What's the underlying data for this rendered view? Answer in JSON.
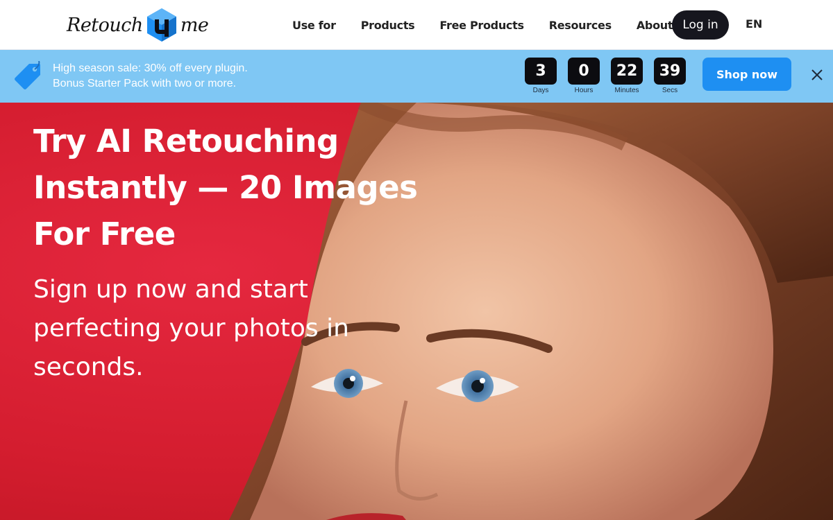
{
  "header": {
    "logo": {
      "left": "Retouch",
      "right": "me",
      "mark_letter": "u"
    },
    "nav": [
      "Use for",
      "Products",
      "Free Products",
      "Resources",
      "About Us"
    ],
    "login_label": "Log in",
    "language": "EN"
  },
  "promo": {
    "line1": "High season sale: 30% off every plugin.",
    "line2": "Bonus Starter Pack with two or more.",
    "countdown": [
      {
        "value": "3",
        "label": "Days"
      },
      {
        "value": "0",
        "label": "Hours"
      },
      {
        "value": "22",
        "label": "Minutes"
      },
      {
        "value": "39",
        "label": "Secs"
      }
    ],
    "shop_label": "Shop now",
    "icons": {
      "tag": "price-tag-icon",
      "close": "close-icon"
    }
  },
  "hero": {
    "title": "Try AI Retouching Instantly — 20 Images For Free",
    "subtitle": "Sign up now and start perfecting your photos in seconds."
  },
  "colors": {
    "promo_bg": "#7fc7f4",
    "shop_button": "#1e8ff2",
    "hero_red": "#d41d2f",
    "login_button": "#16161e",
    "logo_blue": "#1e8ff2"
  }
}
